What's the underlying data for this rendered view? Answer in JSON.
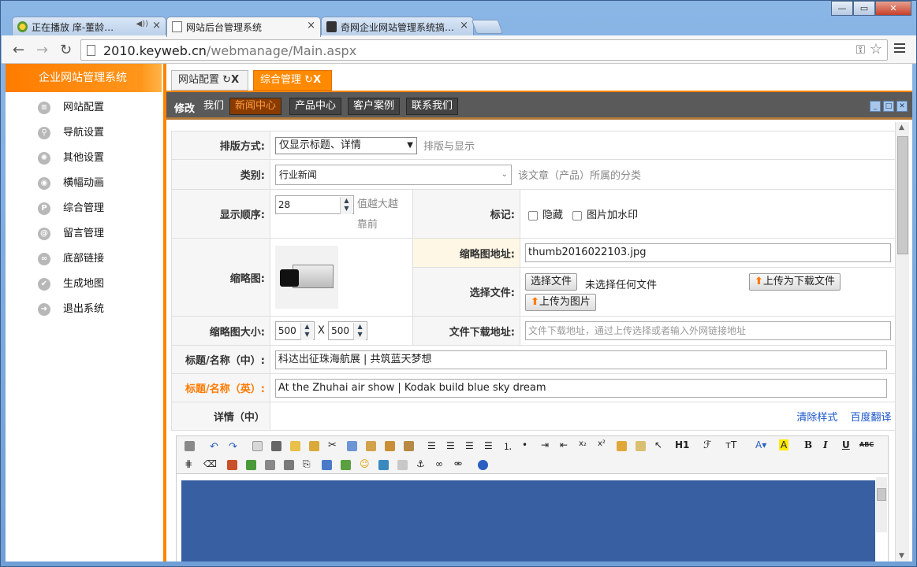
{
  "browser": {
    "tabs": [
      {
        "title": "正在播放 庠-董龄…",
        "audio": "◀))"
      },
      {
        "title": "网站后台管理系统"
      },
      {
        "title": "奇网企业网站管理系统搞…"
      }
    ],
    "url_host": "2010.keyweb.cn",
    "url_path": "/webmanage/Main.aspx"
  },
  "sidebar": {
    "title": "企业网站管理系统",
    "items": [
      {
        "label": "网站配置",
        "icon": "config-icon"
      },
      {
        "label": "导航设置",
        "icon": "navigation-icon"
      },
      {
        "label": "其他设置",
        "icon": "settings-icon"
      },
      {
        "label": "横幅动画",
        "icon": "banner-icon"
      },
      {
        "label": "综合管理",
        "icon": "management-icon"
      },
      {
        "label": "留言管理",
        "icon": "message-icon"
      },
      {
        "label": "底部链接",
        "icon": "link-icon"
      },
      {
        "label": "生成地图",
        "icon": "sitemap-icon"
      },
      {
        "label": "退出系统",
        "icon": "exit-icon"
      }
    ]
  },
  "page_tabs": [
    {
      "label": "网站配置"
    },
    {
      "label": "综合管理"
    }
  ],
  "section_bar": {
    "mode_label": "修改",
    "buttons": [
      "我们",
      "新闻中心",
      "产品中心",
      "客户案例",
      "联系我们"
    ]
  },
  "form": {
    "layout_label": "排版方式:",
    "layout_value": "仅显示标题、详情",
    "layout_hint": "排版与显示",
    "category_label": "类别:",
    "category_value": "行业新闻",
    "category_hint": "该文章（产品）所属的分类",
    "order_label": "显示顺序:",
    "order_value": "28",
    "order_hint": "值越大越靠前",
    "flag_label": "标记:",
    "flag_hidden": "隐藏",
    "flag_watermark": "图片加水印",
    "thumb_label": "缩略图:",
    "thumb_url_label": "缩略图地址:",
    "thumb_url_value": "thumb2016022103.jpg",
    "choose_file_label": "选择文件:",
    "choose_file_button": "选择文件",
    "no_file_text": "未选择任何文件",
    "upload_download_button": "上传为下载文件",
    "upload_image_button": "上传为图片",
    "thumb_size_label": "缩略图大小:",
    "thumb_width": "500",
    "thumb_height": "500",
    "size_sep": "X",
    "download_label": "文件下载地址:",
    "download_placeholder": "文件下载地址，通过上传选择或者输入外网链接地址",
    "title_cn_label": "标题/名称（中）:",
    "title_cn_value": "科达出征珠海航展 | 共筑蓝天梦想",
    "title_en_label": "标题/名称（英）:",
    "title_en_value": "At the Zhuhai air show | Kodak build blue sky dream",
    "detail_label": "详情（中）",
    "clear_style": "清除样式",
    "baidu_translate": "百度翻译"
  },
  "editor": {
    "heading_btn": "H1",
    "font_btn": "ℱ",
    "size_btn": "тT",
    "bold": "B",
    "italic": "I",
    "underline": "U",
    "strike": "ABC"
  },
  "colors": {
    "accent": "#ff8400",
    "editor_bg": "#375fa1",
    "link": "#1a55c8"
  }
}
